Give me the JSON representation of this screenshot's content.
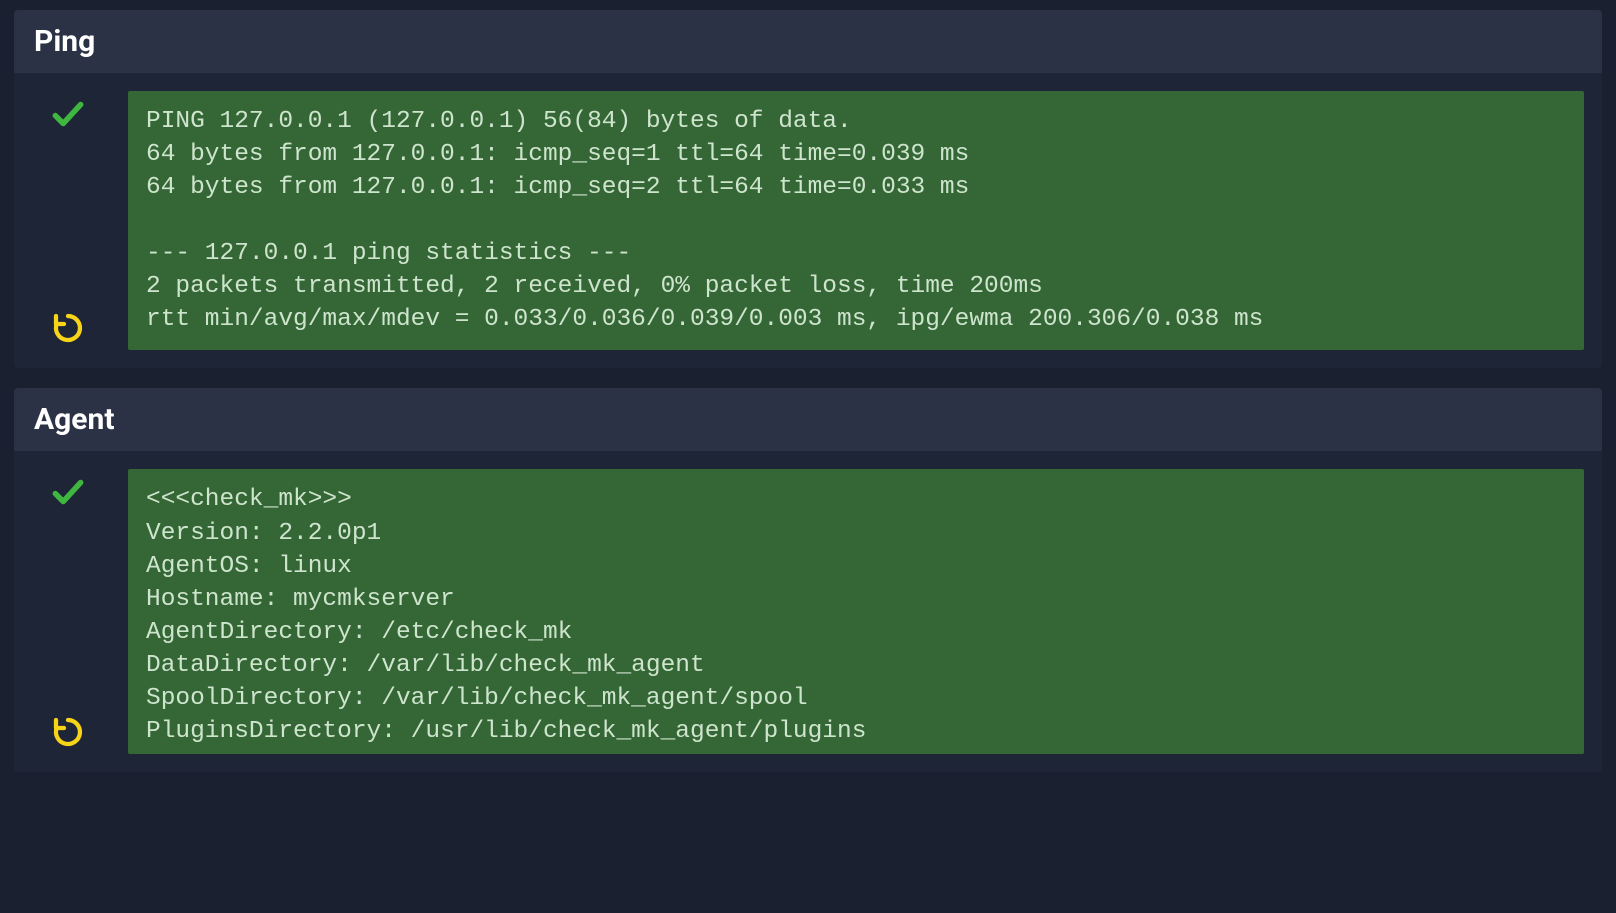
{
  "panels": [
    {
      "id": "ping",
      "title": "Ping",
      "status": "ok",
      "output": "PING 127.0.0.1 (127.0.0.1) 56(84) bytes of data.\n64 bytes from 127.0.0.1: icmp_seq=1 ttl=64 time=0.039 ms\n64 bytes from 127.0.0.1: icmp_seq=2 ttl=64 time=0.033 ms\n\n--- 127.0.0.1 ping statistics ---\n2 packets transmitted, 2 received, 0% packet loss, time 200ms\nrtt min/avg/max/mdev = 0.033/0.036/0.039/0.003 ms, ipg/ewma 200.306/0.038 ms"
    },
    {
      "id": "agent",
      "title": "Agent",
      "status": "ok",
      "output": "<<<check_mk>>>\nVersion: 2.2.0p1\nAgentOS: linux\nHostname: mycmkserver\nAgentDirectory: /etc/check_mk\nDataDirectory: /var/lib/check_mk_agent\nSpoolDirectory: /var/lib/check_mk_agent/spool\nPluginsDirectory: /usr/lib/check_mk_agent/plugins"
    }
  ]
}
